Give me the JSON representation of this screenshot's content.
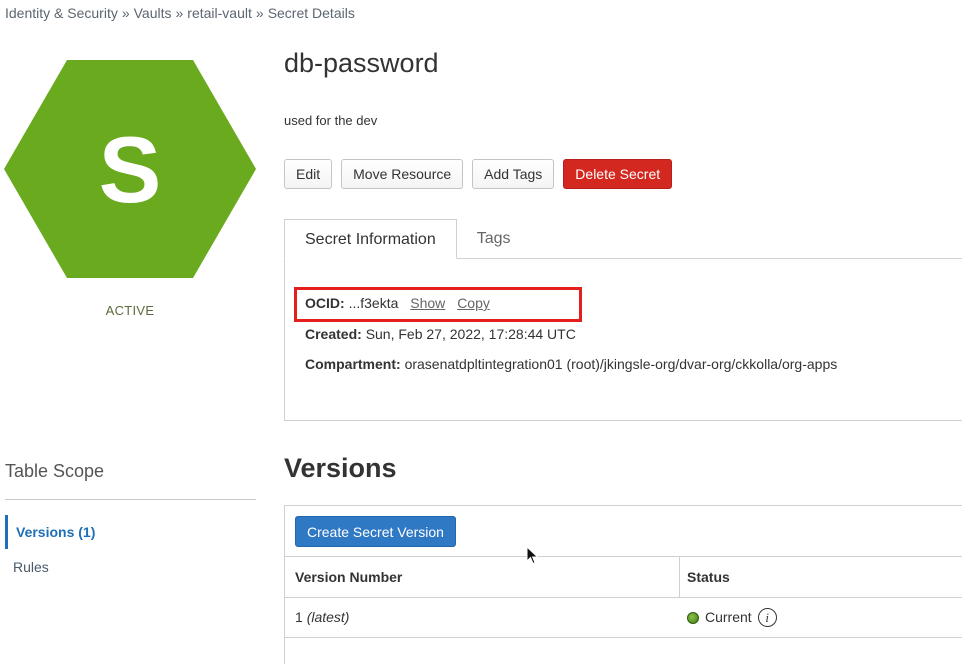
{
  "breadcrumb": {
    "items": [
      "Identity & Security",
      "Vaults",
      "retail-vault",
      "Secret Details"
    ],
    "separator": "»"
  },
  "resource": {
    "icon_letter": "S",
    "icon_color": "#6aaa1e",
    "status": "ACTIVE",
    "name": "db-password",
    "description": "used for the dev"
  },
  "actions": {
    "edit": "Edit",
    "move": "Move Resource",
    "add_tags": "Add Tags",
    "delete": "Delete Secret",
    "delete_color": "#d3281f"
  },
  "tabs": [
    {
      "label": "Secret Information",
      "active": true
    },
    {
      "label": "Tags",
      "active": false
    }
  ],
  "info": {
    "ocid_label": "OCID:",
    "ocid_value": "...f3ekta",
    "show": "Show",
    "copy": "Copy",
    "created_label": "Created:",
    "created_value": "Sun, Feb 27, 2022, 17:28:44 UTC",
    "compartment_label": "Compartment:",
    "compartment_value": "orasenatdpltintegration01 (root)/jkingsle-org/dvar-org/ckkolla/org-apps"
  },
  "scope": {
    "title": "Table Scope",
    "items": [
      {
        "label": "Versions (1)",
        "active": true
      },
      {
        "label": "Rules",
        "active": false
      }
    ]
  },
  "versions": {
    "title": "Versions",
    "create_button": "Create Secret Version",
    "columns": [
      "Version Number",
      "Status"
    ],
    "rows": [
      {
        "number": "1",
        "tag": "(latest)",
        "status": "Current"
      }
    ],
    "status_color": "#5a9e1a"
  }
}
